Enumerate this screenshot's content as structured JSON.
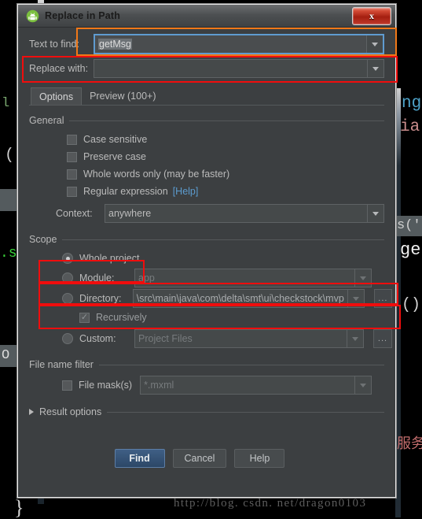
{
  "window": {
    "title": "Replace in Path",
    "app_icon": "android-studio-icon",
    "close_label": "x"
  },
  "find_field": {
    "label_pre": "Text to ",
    "label_accel": "fi",
    "label_post": "nd:",
    "label_full": "Text to find:",
    "value": "getMsg",
    "selected": true
  },
  "replace_field": {
    "label_full": "Replace with:",
    "value": "",
    "placeholder": ""
  },
  "tabs": [
    {
      "label": "Options",
      "active": true
    },
    {
      "label": "Preview (100+)",
      "active": false
    }
  ],
  "general": {
    "title": "General",
    "checkboxes": [
      {
        "label": "Case sensitive",
        "checked": false
      },
      {
        "label": "Preserve case",
        "checked": false
      },
      {
        "label": "Whole words only (may be faster)",
        "checked": false
      },
      {
        "label": "Regular expression",
        "checked": false,
        "link": "[Help]"
      }
    ],
    "context": {
      "label": "Context:",
      "value": "anywhere"
    }
  },
  "scope": {
    "title": "Scope",
    "whole_project": {
      "label": "Whole project",
      "selected": true
    },
    "module": {
      "label": "Module:",
      "selected": false,
      "value": "app"
    },
    "directory": {
      "label": "Directory:",
      "selected": false,
      "value": "\\src\\main\\java\\com\\delta\\smt\\ui\\checkstock\\mvp",
      "browse": "..."
    },
    "recursively": {
      "label": "Recursively",
      "checked": true
    },
    "custom": {
      "label": "Custom:",
      "selected": false,
      "value": "Project Files",
      "browse": "..."
    }
  },
  "file_filter": {
    "title": "File name filter",
    "mask": {
      "label": "File mask(s)",
      "checked": false,
      "value": "*.mxml"
    }
  },
  "result_options": {
    "label": "Result options",
    "expanded": false
  },
  "buttons": {
    "find": "Find",
    "cancel": "Cancel",
    "help": "Help"
  },
  "background": {
    "watermark": "http://blog. csdn. net/dragon0103",
    "brace": "}",
    "left_fragments": [
      "l",
      "(",
      ".s",
      "O"
    ],
    "right_fragments": [
      "ng",
      "ia",
      "s('",
      "ge",
      "()",
      "服务"
    ]
  },
  "annotations": {
    "orange_find_field": "highlight-text-to-find",
    "red_replace_field": "highlight-replace-with",
    "red_whole_project": "highlight-whole-project",
    "red_module": "highlight-module",
    "red_directory": "highlight-directory"
  },
  "colors": {
    "dialog_bg": "#3c3f41",
    "accent_red": "#f00d0d",
    "accent_orange": "#f07818",
    "link_blue": "#5c9ccf",
    "focus_blue": "#5f9bd0"
  }
}
